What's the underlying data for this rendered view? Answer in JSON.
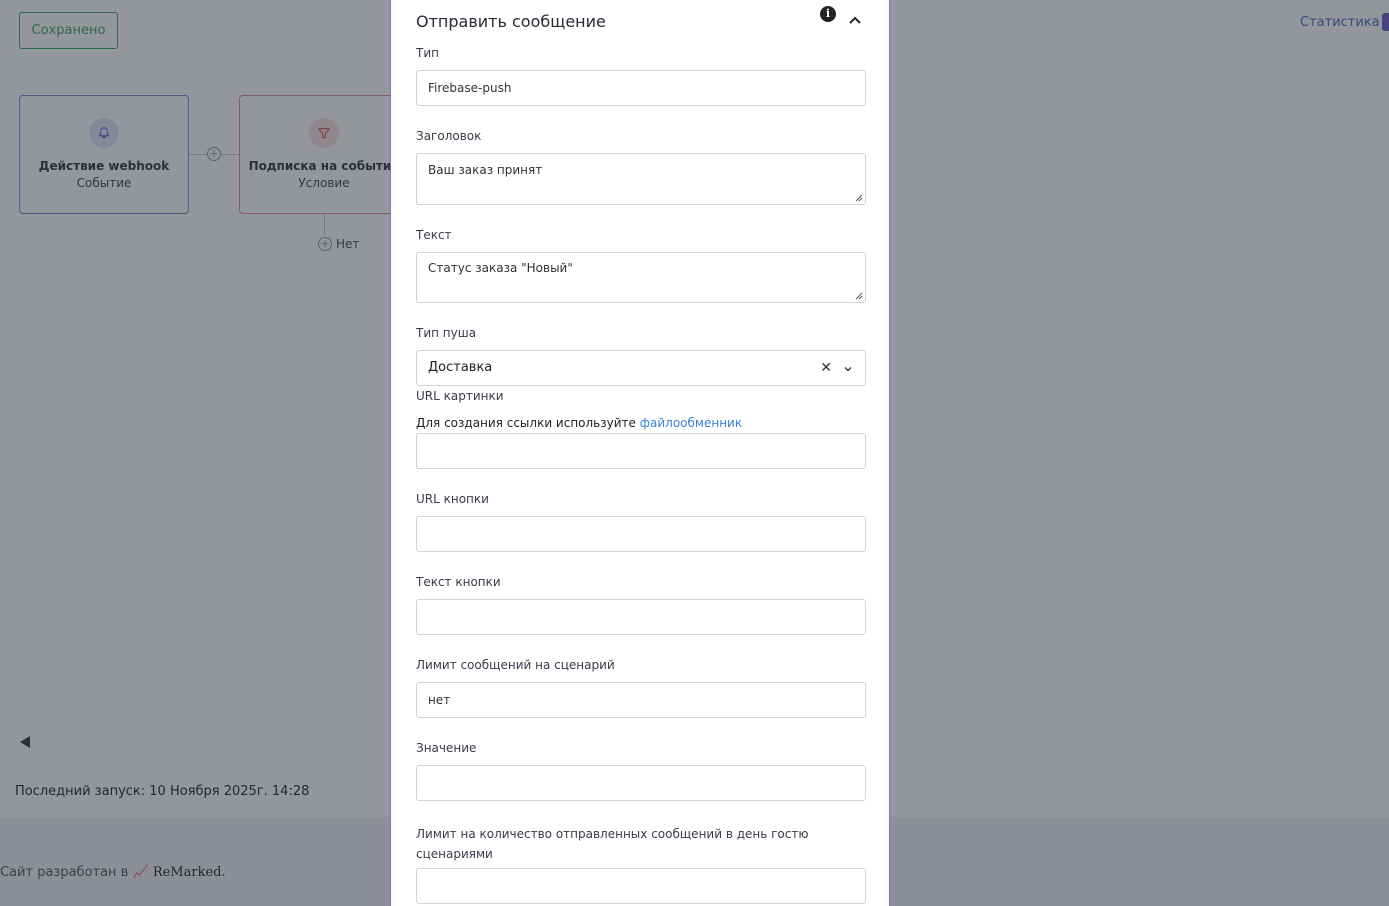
{
  "background": {
    "saved_button": "Сохранено",
    "stats_link": "Статистика",
    "nodes": [
      {
        "title": "Действие webhook",
        "subtitle": "Событие",
        "icon": "bell-icon"
      },
      {
        "title": "Подписка на событие",
        "subtitle": "Условие",
        "icon": "filter-icon"
      }
    ],
    "branch_no_label": "Нет",
    "last_run": "Последний запуск: 10 Ноября 2025г. 14:28",
    "footer_prefix": "Сайт разработан в",
    "footer_brand": "ReMarked."
  },
  "panel": {
    "title": "Отправить сообщение",
    "fields": {
      "type": {
        "label": "Тип",
        "value": "Firebase-push"
      },
      "heading": {
        "label": "Заголовок",
        "value": "Ваш заказ принят"
      },
      "text": {
        "label": "Текст",
        "value": "Статус заказа \"Новый\""
      },
      "push_type": {
        "label": "Тип пуша",
        "value": "Доставка"
      },
      "image_url": {
        "label": "URL картинки",
        "hint": "Для создания ссылки используйте",
        "hint_link": "файлообменник",
        "value": ""
      },
      "button_url": {
        "label": "URL кнопки",
        "value": ""
      },
      "button_text": {
        "label": "Текст кнопки",
        "value": ""
      },
      "scenario_limit": {
        "label": "Лимит сообщений на сценарий",
        "value": "нет"
      },
      "limit_value": {
        "label": "Значение",
        "value": ""
      },
      "daily_limit": {
        "label": "Лимит на количество отправленных сообщений в день гостю сценариями",
        "value": ""
      }
    }
  },
  "colors": {
    "accent_purple": "#7b6fd1",
    "saved_green": "#2fa65a",
    "link_blue": "#3b80d6",
    "overlay": "rgba(40,46,56,0.5)"
  }
}
